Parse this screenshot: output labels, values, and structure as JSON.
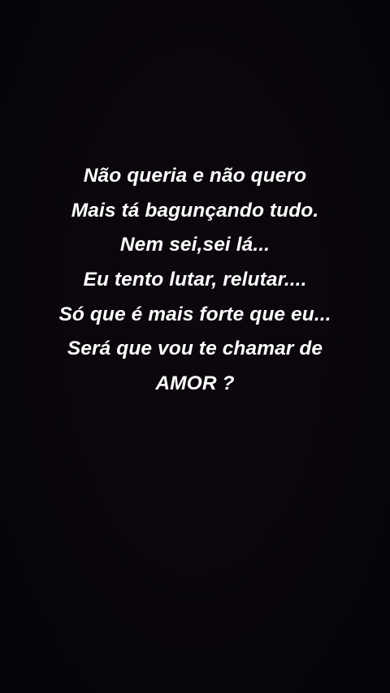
{
  "background_color": "#0a060b",
  "text_color": "#ffffff",
  "lines": [
    "Não queria e não quero",
    "Mais tá bagunçando tudo.",
    "Nem sei,sei lá...",
    "Eu tento lutar, relutar....",
    "Só que é mais forte que eu...",
    "Será que vou te chamar de",
    "AMOR ?"
  ]
}
